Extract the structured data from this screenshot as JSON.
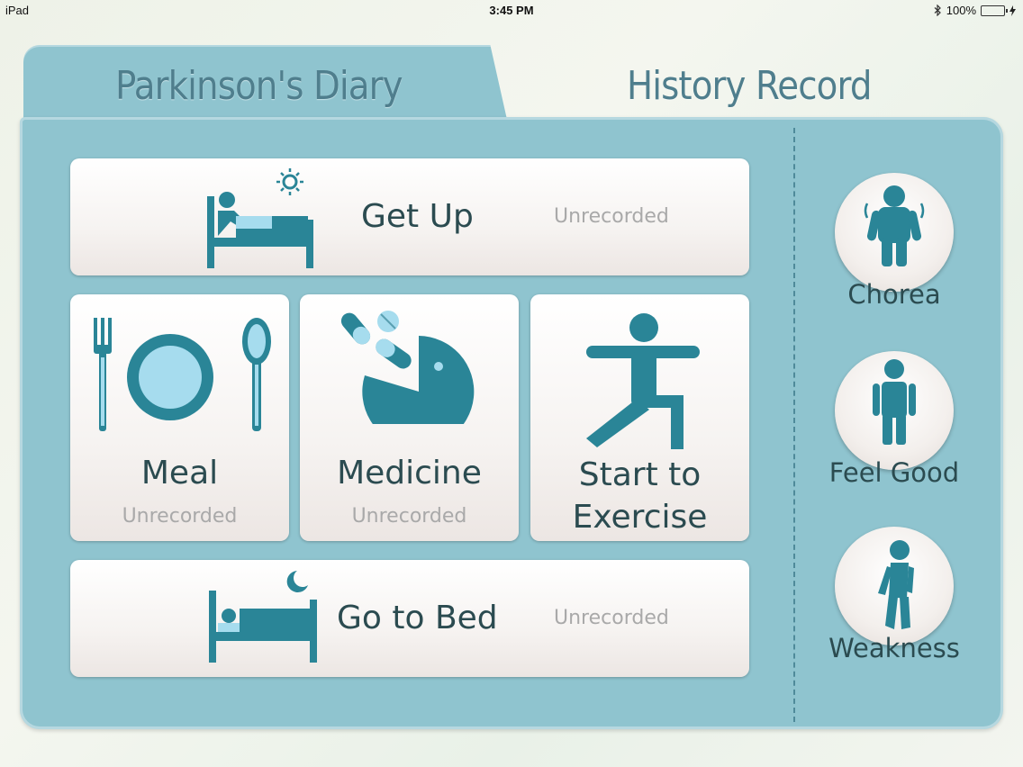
{
  "status_bar": {
    "device": "iPad",
    "time": "3:45 PM",
    "battery": "100%"
  },
  "tabs": [
    {
      "label": "Parkinson's Diary"
    },
    {
      "label": "History Record"
    }
  ],
  "cards": {
    "get_up": {
      "label": "Get Up",
      "status": "Unrecorded"
    },
    "meal": {
      "label": "Meal",
      "status": "Unrecorded"
    },
    "medicine": {
      "label": "Medicine",
      "status": "Unrecorded"
    },
    "exercise": {
      "label_line1": "Start to",
      "label_line2": "Exercise"
    },
    "go_to_bed": {
      "label": "Go to Bed",
      "status": "Unrecorded"
    }
  },
  "symptoms": [
    {
      "label": "Chorea"
    },
    {
      "label": "Feel Good"
    },
    {
      "label": "Weakness"
    }
  ],
  "colors": {
    "accent": "#2a8597",
    "folder": "#8fc4cf",
    "light_blue": "#a6dcee"
  }
}
